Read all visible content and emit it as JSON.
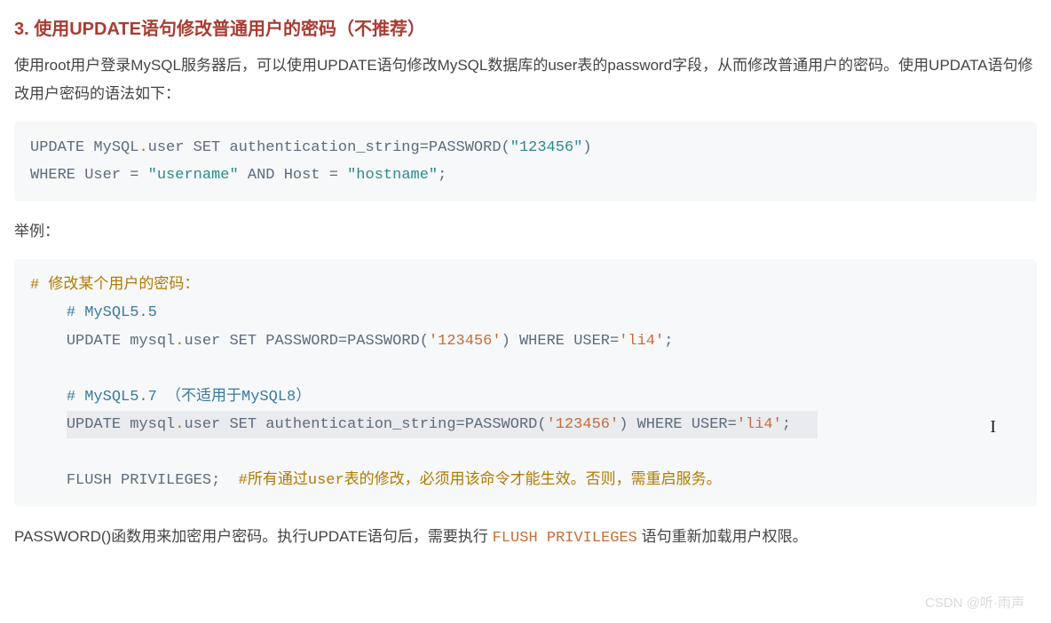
{
  "heading": "3. 使用UPDATE语句修改普通用户的密码（不推荐）",
  "intro": "使用root用户登录MySQL服务器后，可以使用UPDATE语句修改MySQL数据库的user表的password字段，从而修改普通用户的密码。使用UPDATA语句修改用户密码的语法如下：",
  "code1": {
    "kw_update": "UPDATE",
    "db": "MySQL",
    "tbl": "user",
    "kw_set": "SET",
    "col": "authentication_string",
    "fn": "PASSWORD",
    "str_pwd": "\"123456\"",
    "kw_where": "WHERE",
    "col_user": "User",
    "val_user": "\"username\"",
    "kw_and": "AND",
    "col_host": "Host",
    "val_host": "\"hostname\"",
    "semi": ";"
  },
  "example_label": "举例：",
  "code2": {
    "c_top": "# 修改某个用户的密码：",
    "c_v55": "# MySQL5.5",
    "u55_update": "UPDATE",
    "u55_db": "mysql",
    "u55_tbl": "user",
    "u55_set": "SET",
    "u55_col": "PASSWORD",
    "u55_fn": "PASSWORD",
    "u55_pwd": "'123456'",
    "u55_where": "WHERE",
    "u55_usercol": "USER",
    "u55_userval": "'li4'",
    "c_v57": "# MySQL5.7 （不适用于MySQL8）",
    "u57_update": "UPDATE",
    "u57_db": "mysql",
    "u57_tbl": "user",
    "u57_set": "SET",
    "u57_col": "authentication_string",
    "u57_fn": "PASSWORD",
    "u57_pwd": "'123456'",
    "u57_where": "WHERE",
    "u57_usercol": "USER",
    "u57_userval": "'li4'",
    "flush": "FLUSH",
    "priv": "PRIVILEGES",
    "flush_cmt": "#所有通过user表的修改，必须用该命令才能生效。否则，需重启服务。"
  },
  "outro_before": "PASSWORD()函数用来加密用户密码。执行UPDATE语句后，需要执行 ",
  "outro_code": "FLUSH PRIVILEGES",
  "outro_after": " 语句重新加载用户权限。",
  "watermark": "CSDN @听·雨声"
}
